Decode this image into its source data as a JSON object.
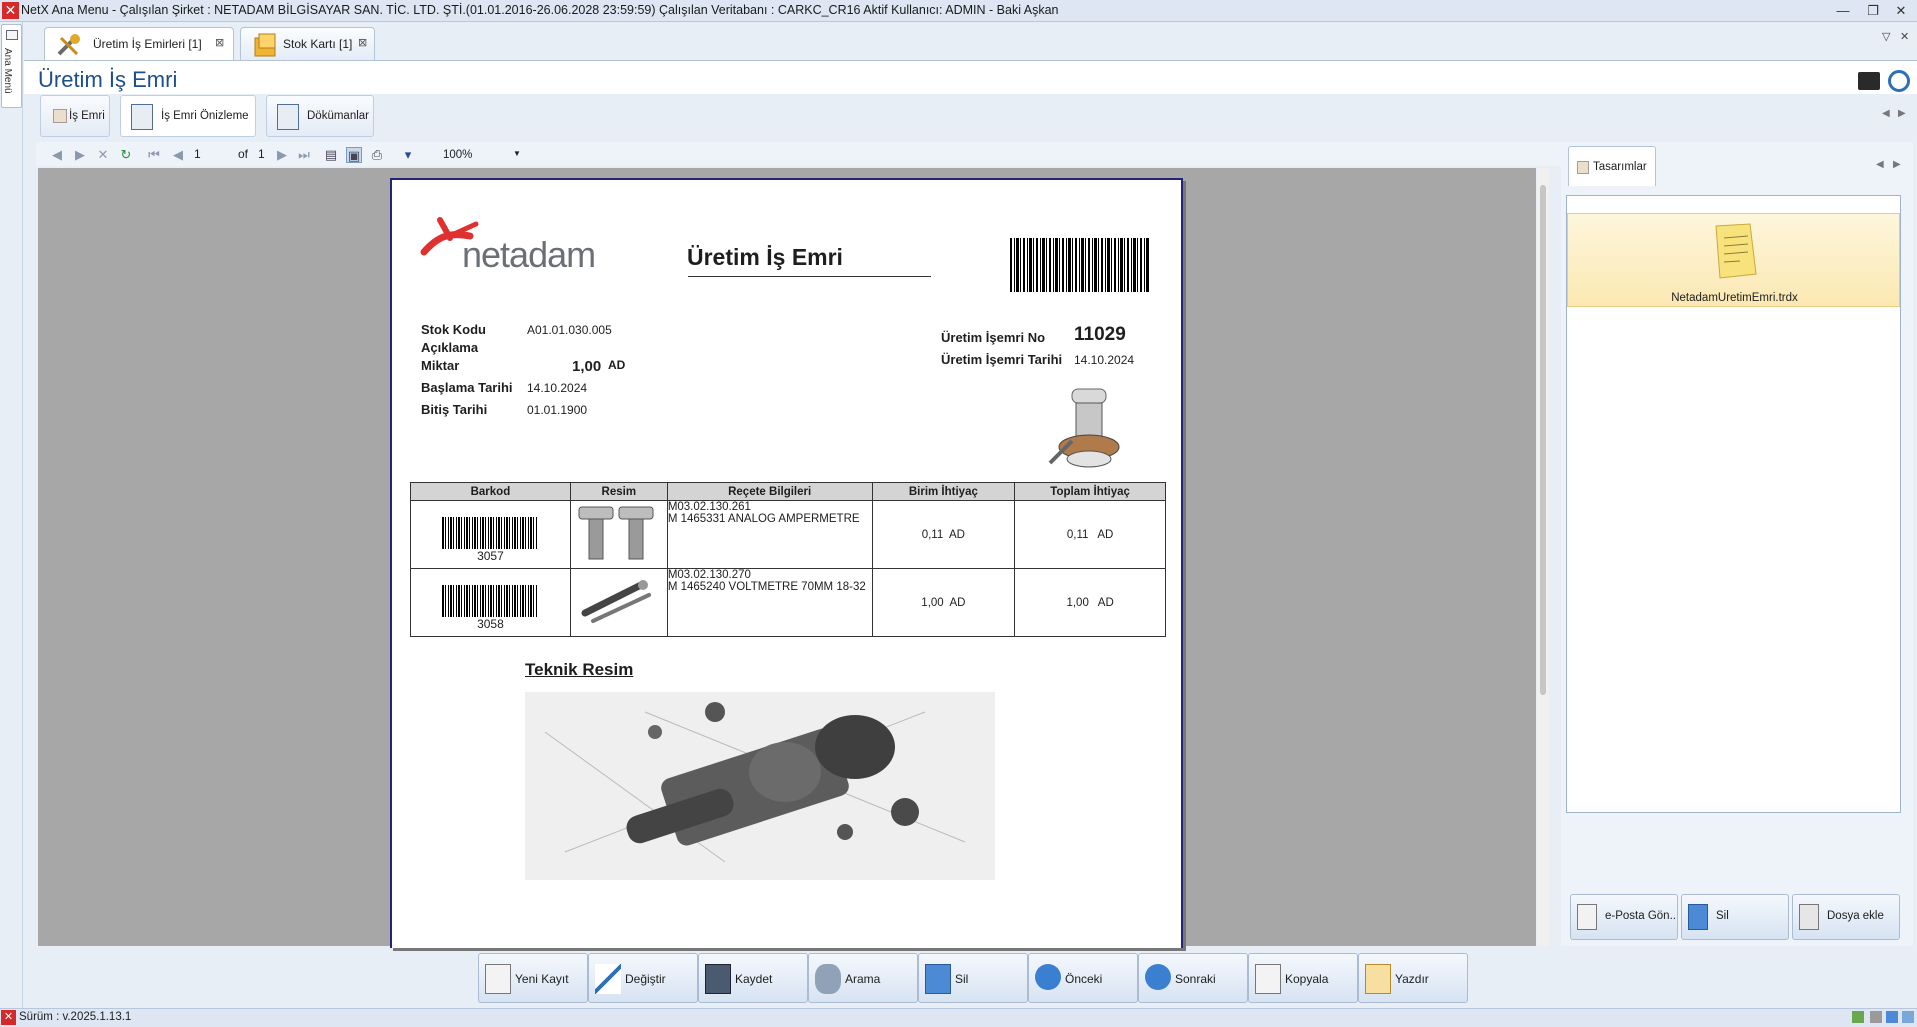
{
  "window": {
    "title": "NetX Ana Menu - Çalışılan Şirket : NETADAM BİLGİSAYAR SAN. TİC. LTD. ŞTİ.(01.01.2016-26.06.2028 23:59:59) Çalışılan Veritabanı : CARKC_CR16  Aktif Kullanıcı: ADMIN - Baki Aşkan",
    "minimize": "—",
    "restore": "❐",
    "close": "✕"
  },
  "side_menu": {
    "label": "Ana Menü"
  },
  "doc_tabs": [
    {
      "label": "Üretim İş Emirleri [1]",
      "close": "⊠"
    },
    {
      "label": "Stok Kartı [1]",
      "close": "⊠"
    }
  ],
  "page": {
    "title": "Üretim İş Emri"
  },
  "sub_tabs": [
    {
      "label": "İş Emri"
    },
    {
      "label": "İş Emri Önizleme"
    },
    {
      "label": "Dökümanlar"
    }
  ],
  "viewer_toolbar": {
    "page_value": "1",
    "of_label": "of",
    "page_count": "1",
    "zoom": "100%"
  },
  "report": {
    "logo_text": "netadam",
    "title": "Üretim İş Emri",
    "fields": [
      {
        "label": "Stok Kodu",
        "value": "A01.01.030.005"
      },
      {
        "label": "Açıklama",
        "value": ""
      },
      {
        "label": "Miktar",
        "value": "1,00",
        "unit": "AD"
      },
      {
        "label": "Başlama Tarihi",
        "value": "14.10.2024"
      },
      {
        "label": "Bitiş Tarihi",
        "value": "01.01.1900"
      }
    ],
    "order_no_label": "Üretim İşemri No",
    "order_no": "11029",
    "order_date_label": "Üretim İşemri Tarihi",
    "order_date": "14.10.2024",
    "table": {
      "headers": [
        "Barkod",
        "Resim",
        "Reçete Bilgileri",
        "Birim İhtiyaç",
        "Toplam İhtiyaç"
      ],
      "rows": [
        {
          "barcode": "3057",
          "code": "M03.02.130.261",
          "desc": "M 1465331 ANALOG AMPERMETRE",
          "unit_need": "0,11",
          "unit_need_u": "AD",
          "total_need": "0,11",
          "total_need_u": "AD"
        },
        {
          "barcode": "3058",
          "code": "M03.02.130.270",
          "desc": "M 1465240 VOLTMETRE 70MM 18-32",
          "unit_need": "1,00",
          "unit_need_u": "AD",
          "total_need": "1,00",
          "total_need_u": "AD"
        }
      ]
    },
    "technical_title": "Teknik Resim"
  },
  "right_panel": {
    "tab_label": "Tasarımlar",
    "design_file": "NetadamUretimEmri.trdx",
    "buttons": [
      {
        "label": "e-Posta Gön.."
      },
      {
        "label": "Sil"
      },
      {
        "label": "Dosya ekle"
      }
    ]
  },
  "bottom_buttons": [
    {
      "label": "Yeni Kayıt"
    },
    {
      "label": "Değiştir"
    },
    {
      "label": "Kaydet"
    },
    {
      "label": "Arama"
    },
    {
      "label": "Sil"
    },
    {
      "label": "Önceki"
    },
    {
      "label": "Sonraki"
    },
    {
      "label": "Kopyala"
    },
    {
      "label": "Yazdır"
    }
  ],
  "status": {
    "version": "Sürüm : v.2025.1.13.1"
  },
  "colors": {
    "accent": "#1e4e8c",
    "logo_red": "#e03131",
    "logo_gray": "#6b6f76"
  }
}
